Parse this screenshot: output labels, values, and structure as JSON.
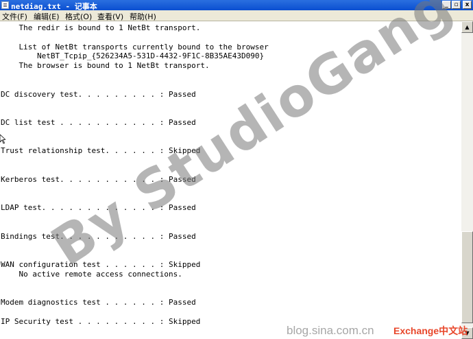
{
  "window": {
    "title": "netdiag.txt - 记事本",
    "controls": {
      "minimize": "_",
      "maximize": "▫",
      "close": "x"
    }
  },
  "menu": [
    "文件(F)",
    "编辑(E)",
    "格式(O)",
    "查看(V)",
    "帮助(H)"
  ],
  "document": {
    "text": "    The redir is bound to 1 NetBt transport.\n\n    List of NetBt transports currently bound to the browser\n        NetBT_Tcpip_{526234A5-531D-4432-9F1C-8B35AE43D090}\n    The browser is bound to 1 NetBt transport.\n\n\nDC discovery test. . . . . . . . . : Passed\n\n\nDC list test . . . . . . . . . . . : Passed\n\n\nTrust relationship test. . . . . . : Skipped\n\n\nKerberos test. . . . . . . . . . . : Passed\n\n\nLDAP test. . . . . . . . . . . . . : Passed\n\n\nBindings test. . . . . . . . . . . : Passed\n\n\nWAN configuration test . . . . . . : Skipped\n    No active remote access connections.\n\n\nModem diagnostics test . . . . . . : Passed\n\nIP Security test . . . . . . . . . : Skipped"
  },
  "watermark": {
    "text": "By StudioGang",
    "site": "blog.sina.com.cn",
    "brand": "Exchange中文站"
  },
  "icons": [
    "notepad-icon",
    "mouse-cursor-icon",
    "scroll-up-arrow-icon",
    "scroll-down-arrow-icon"
  ]
}
